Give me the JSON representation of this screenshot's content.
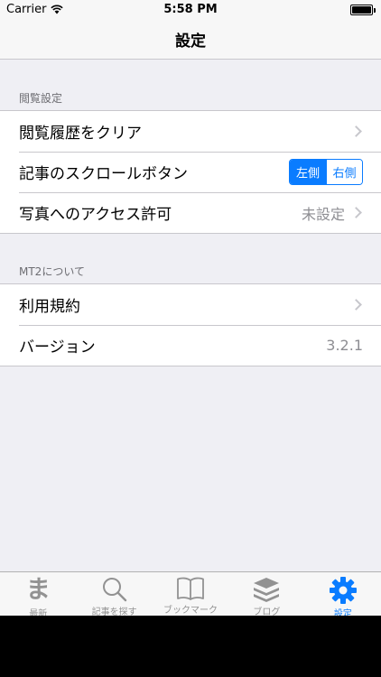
{
  "status_bar": {
    "carrier": "Carrier",
    "time": "5:58 PM"
  },
  "nav": {
    "title": "設定"
  },
  "sections": [
    {
      "header": "閲覧設定",
      "rows": [
        {
          "label": "閲覧履歴をクリア",
          "accessory": "chevron"
        },
        {
          "label": "記事のスクロールボタン",
          "accessory": "segmented",
          "segments": [
            "左側",
            "右側"
          ],
          "selected": "左側"
        },
        {
          "label": "写真へのアクセス許可",
          "detail": "未設定",
          "accessory": "chevron"
        }
      ]
    },
    {
      "header": "MT2について",
      "rows": [
        {
          "label": "利用規約",
          "accessory": "chevron"
        },
        {
          "label": "バージョン",
          "detail": "3.2.1"
        }
      ]
    }
  ],
  "tabbar": {
    "items": [
      {
        "label": "最新",
        "icon": "ma-icon",
        "glyph": "ま"
      },
      {
        "label": "記事を探す",
        "icon": "search-icon"
      },
      {
        "label": "ブックマーク",
        "icon": "book-icon"
      },
      {
        "label": "ブログ",
        "icon": "stack-icon"
      },
      {
        "label": "設定",
        "icon": "gear-icon",
        "active": true
      }
    ]
  },
  "colors": {
    "accent": "#0a7cff",
    "background": "#efeff4",
    "inactive_tab": "#929292"
  }
}
